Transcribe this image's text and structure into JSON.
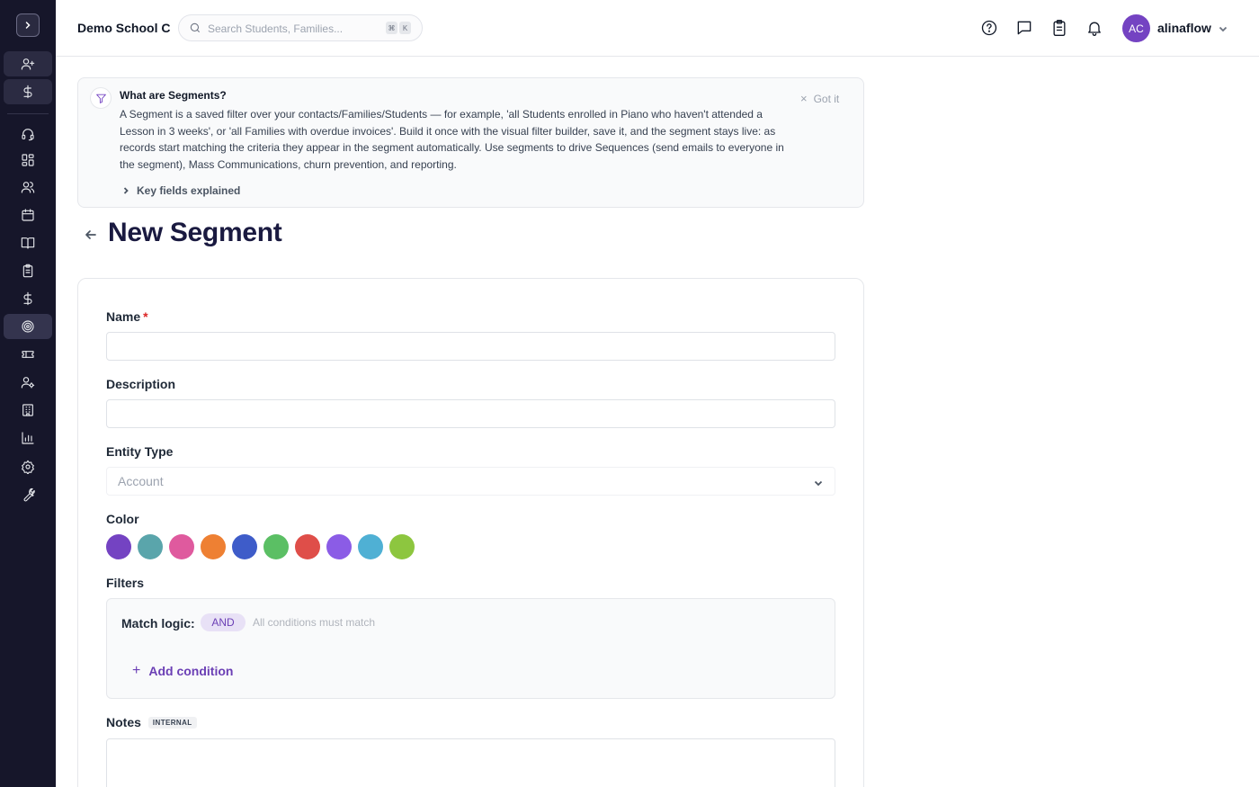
{
  "header": {
    "school_name": "Demo School C",
    "search_placeholder": "Search Students, Families...",
    "shortcut_keys": [
      "⌘",
      "K"
    ],
    "user_initials": "AC",
    "username": "alinaflow"
  },
  "sidebar": {
    "items": [
      {
        "icon": "user-plus-icon"
      },
      {
        "icon": "dollar-icon"
      },
      {
        "icon": "headset-icon"
      },
      {
        "icon": "dashboard-icon"
      },
      {
        "icon": "users-icon"
      },
      {
        "icon": "calendar-icon"
      },
      {
        "icon": "book-icon"
      },
      {
        "icon": "clipboard-icon"
      },
      {
        "icon": "dollar-icon"
      },
      {
        "icon": "target-icon",
        "active": true
      },
      {
        "icon": "ticket-icon"
      },
      {
        "icon": "user-settings-icon"
      },
      {
        "icon": "building-icon"
      },
      {
        "icon": "bar-chart-icon"
      },
      {
        "icon": "gear-icon"
      },
      {
        "icon": "wrench-icon"
      }
    ]
  },
  "banner": {
    "title": "What are Segments?",
    "body": "A Segment is a saved filter over your contacts/Families/Students — for example, 'all Students enrolled in Piano who haven't attended a Lesson in 3 weeks', or 'all Families with overdue invoices'. Build it once with the visual filter builder, save it, and the segment stays live: as records start matching the criteria they appear in the segment automatically. Use segments to drive Sequences (send emails to everyone in the segment), Mass Communications, churn prevention, and reporting.",
    "dismiss_label": "Got it",
    "key_fields_label": "Key fields explained"
  },
  "page": {
    "title": "New Segment"
  },
  "form": {
    "name_label": "Name",
    "name_required_mark": "*",
    "name_value": "",
    "description_label": "Description",
    "description_value": "",
    "entity_type_label": "Entity Type",
    "entity_type_value": "Account",
    "color_label": "Color",
    "colors": [
      "#7443c2",
      "#5aa5ab",
      "#df5a9e",
      "#ee8033",
      "#3e5cc9",
      "#5bbf64",
      "#df4e49",
      "#8b5ce6",
      "#4fb0d4",
      "#8dc63f"
    ],
    "filters_label": "Filters",
    "match_logic_label": "Match logic:",
    "match_logic_value": "AND",
    "match_logic_hint": "All conditions must match",
    "add_condition_label": "Add condition",
    "notes_label": "Notes",
    "notes_badge": "INTERNAL",
    "notes_value": ""
  }
}
